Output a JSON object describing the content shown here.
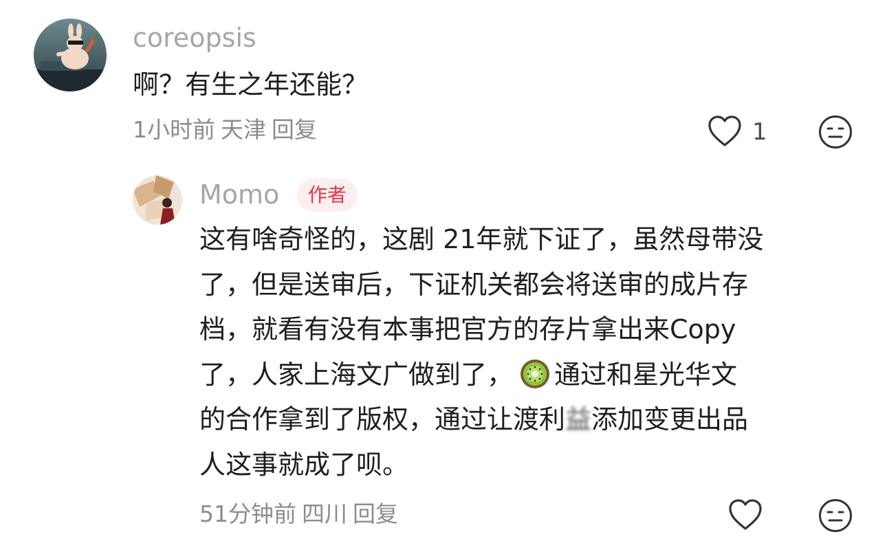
{
  "comment": {
    "username": "coreopsis",
    "text": "啊？有生之年还能？",
    "time": "1小时前",
    "location": "天津",
    "reply_label": "回复",
    "like_count": "1"
  },
  "reply": {
    "username": "Momo",
    "badge": "作者",
    "lines": [
      "这有啥奇怪的，这剧 21年就下证了，虽然母带没",
      "了，但是送审后，下证机关都会将送审的成片存",
      "档，就看有没有本事把官方的存片拿出来Copy",
      "了，人家上海文广做到了，",
      "通过和星光华文",
      "的合作拿到了版权，通过让渡利",
      "益",
      "添加变更出品",
      "人这事就成了呗。"
    ],
    "emoji_icon": "kiwi-icon",
    "time": "51分钟前",
    "location": "四川",
    "reply_label": "回复"
  },
  "colors": {
    "username": "#a6a6a6",
    "meta": "#8c8c8c",
    "badge_bg": "#fdeff0",
    "badge_text": "#e6324b",
    "text": "#1f1f1f"
  },
  "icons": {
    "like": "heart-outline-icon",
    "dislike": "unamused-face-icon"
  }
}
